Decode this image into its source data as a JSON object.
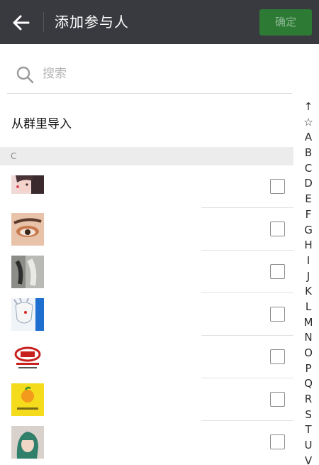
{
  "header": {
    "title": "添加参与人",
    "confirm_label": "确定"
  },
  "search": {
    "placeholder": "搜索"
  },
  "import_label": "从群里导入",
  "section_header": "C",
  "contacts": [
    {
      "avatar": "avatar-girl-closeup"
    },
    {
      "avatar": "avatar-eye-makeup"
    },
    {
      "avatar": "avatar-photo-feet"
    },
    {
      "avatar": "avatar-anime-character"
    },
    {
      "avatar": "avatar-red-logo"
    },
    {
      "avatar": "avatar-yellow-orange-logo"
    },
    {
      "avatar": "avatar-green-hair"
    }
  ],
  "index_letters": [
    "↑",
    "☆",
    "A",
    "B",
    "C",
    "D",
    "E",
    "F",
    "G",
    "H",
    "I",
    "J",
    "K",
    "L",
    "M",
    "N",
    "O",
    "P",
    "Q",
    "R",
    "S",
    "T",
    "U",
    "V"
  ]
}
